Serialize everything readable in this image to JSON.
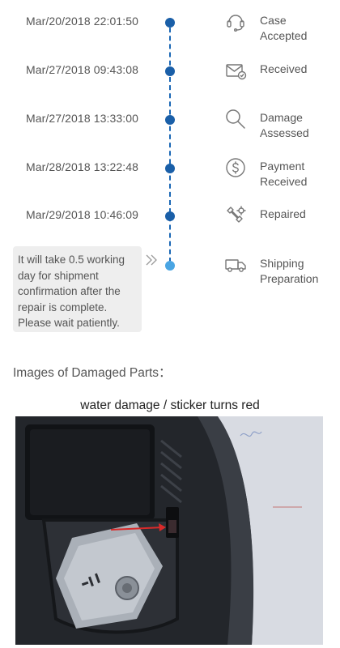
{
  "timeline": {
    "steps": [
      {
        "timestamp": "Mar/20/2018 22:01:50",
        "status_lines": [
          "Case",
          "Accepted"
        ],
        "icon": "headset-icon"
      },
      {
        "timestamp": "Mar/27/2018 09:43:08",
        "status_lines": [
          "Received"
        ],
        "icon": "envelope-check-icon"
      },
      {
        "timestamp": "Mar/27/2018 13:33:00",
        "status_lines": [
          "Damage",
          "Assessed"
        ],
        "icon": "magnifier-icon"
      },
      {
        "timestamp": "Mar/28/2018 13:22:48",
        "status_lines": [
          "Payment",
          "Received"
        ],
        "icon": "dollar-coin-icon"
      },
      {
        "timestamp": "Mar/29/2018 10:46:09",
        "status_lines": [
          "Repaired"
        ],
        "icon": "wrench-gear-icon"
      },
      {
        "timestamp": "",
        "status_lines": [
          "Shipping",
          "Preparation"
        ],
        "icon": "truck-icon"
      }
    ],
    "current_note_lines": [
      "It will take 0.5 working",
      "day for shipment",
      "confirmation after the",
      "repair is complete.",
      "Please wait patiently."
    ]
  },
  "damaged_parts": {
    "title": "Images of Damaged Parts：",
    "caption": "water damage / sticker turns red"
  },
  "colors": {
    "timeline_line": "#1a67b5",
    "done_dot": "#1a5fa8",
    "current_dot": "#4aa5e3",
    "note_bg": "#eeeeee"
  }
}
